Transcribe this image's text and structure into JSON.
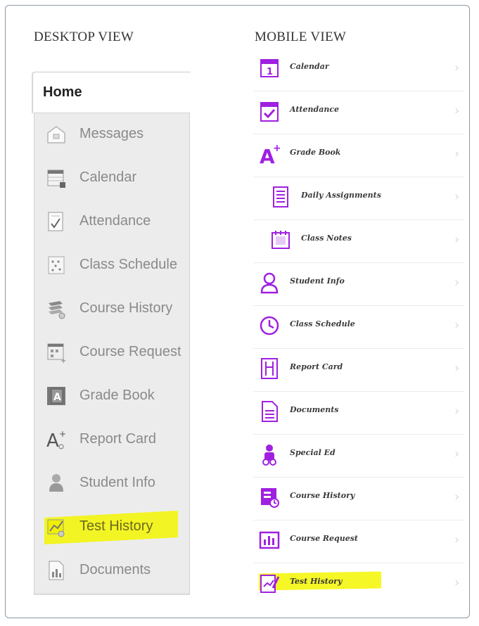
{
  "desktop": {
    "title": "DESKTOP VIEW",
    "home_tab": "Home",
    "items": [
      {
        "label": "Messages",
        "icon": "messages-icon"
      },
      {
        "label": "Calendar",
        "icon": "calendar-icon"
      },
      {
        "label": "Attendance",
        "icon": "attendance-icon"
      },
      {
        "label": "Class Schedule",
        "icon": "class-schedule-icon"
      },
      {
        "label": "Course History",
        "icon": "course-history-icon"
      },
      {
        "label": "Course Request",
        "icon": "course-request-icon"
      },
      {
        "label": "Grade Book",
        "icon": "grade-book-icon"
      },
      {
        "label": "Report Card",
        "icon": "report-card-icon"
      },
      {
        "label": "Student Info",
        "icon": "student-info-icon"
      },
      {
        "label": "Test History",
        "icon": "test-history-icon",
        "highlighted": true
      },
      {
        "label": "Documents",
        "icon": "documents-icon"
      }
    ]
  },
  "mobile": {
    "title": "MOBILE VIEW",
    "accent_color": "#a020e0",
    "highlight_color": "#f4f600",
    "items": [
      {
        "label": "Calendar",
        "icon": "calendar-icon"
      },
      {
        "label": "Attendance",
        "icon": "attendance-icon"
      },
      {
        "label": "Grade Book",
        "icon": "grade-book-icon"
      },
      {
        "label": "Daily Assignments",
        "icon": "daily-assignments-icon",
        "indent": true
      },
      {
        "label": "Class Notes",
        "icon": "class-notes-icon",
        "indent": true
      },
      {
        "label": "Student Info",
        "icon": "student-info-icon"
      },
      {
        "label": "Class Schedule",
        "icon": "class-schedule-icon"
      },
      {
        "label": "Report Card",
        "icon": "report-card-icon"
      },
      {
        "label": "Documents",
        "icon": "documents-icon"
      },
      {
        "label": "Special Ed",
        "icon": "special-ed-icon"
      },
      {
        "label": "Course History",
        "icon": "course-history-icon"
      },
      {
        "label": "Course Request",
        "icon": "course-request-icon"
      },
      {
        "label": "Test History",
        "icon": "test-history-icon",
        "highlighted": true
      }
    ],
    "chevron": "›"
  }
}
